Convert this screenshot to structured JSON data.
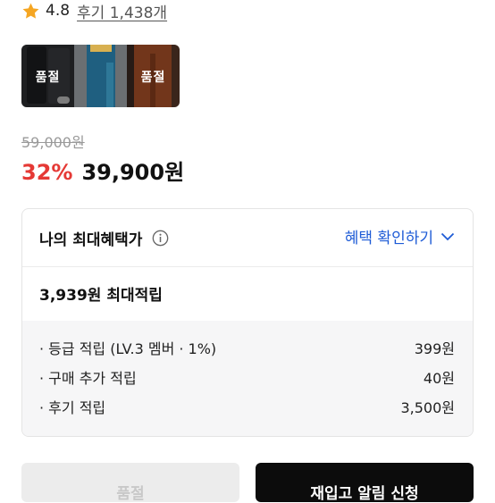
{
  "rating": {
    "value": "4.8",
    "review_link": "후기 1,438개"
  },
  "thumbnails": [
    {
      "badge": "품절"
    },
    {
      "badge": ""
    },
    {
      "badge": "품절"
    }
  ],
  "price": {
    "original": "59,000원",
    "discount": "32%",
    "sale": "39,900원"
  },
  "benefit": {
    "title": "나의 최대혜택가",
    "toggle_label": "혜택 확인하기",
    "summary": "3,939원 최대적립",
    "details": [
      {
        "label": "· 등급 적립 (LV.3 멤버 · 1%)",
        "value": "399원"
      },
      {
        "label": "· 구매 추가 적립",
        "value": "40원"
      },
      {
        "label": "· 후기 적립",
        "value": "3,500원"
      }
    ]
  },
  "buttons": {
    "soldout": "품절",
    "restock": "재입고 알림 신청"
  },
  "colors": {
    "accent": "#e53935",
    "link": "#1e5bd6",
    "star": "#f5a623"
  }
}
